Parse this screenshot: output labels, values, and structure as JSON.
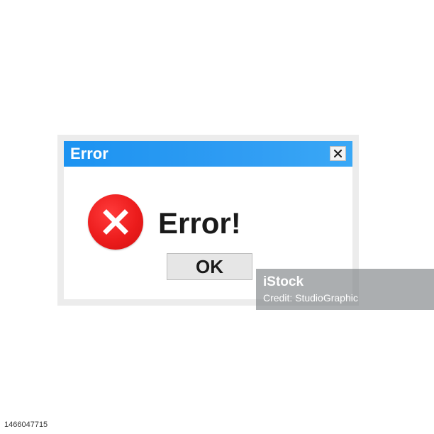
{
  "dialog": {
    "title": "Error",
    "message": "Error!",
    "ok_label": "OK",
    "title_bar_color": "#1c93f1",
    "error_icon_color": "#ec1c1c",
    "icons": {
      "close": "close-icon",
      "error": "error-x-circle-icon"
    }
  },
  "watermark": {
    "brand": "iStock",
    "credit": "Credit: StudioGraphic"
  },
  "image_id": "1466047715"
}
